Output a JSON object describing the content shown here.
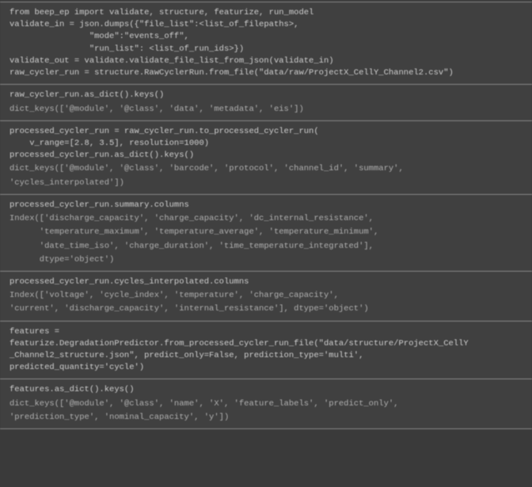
{
  "cells": [
    {
      "lines": [
        "from beep_ep import validate, structure, featurize, run_model",
        "",
        "validate_in = json.dumps({\"file_list\":<list_of_filepaths>,",
        "                \"mode\":\"events_off\",",
        "                \"run_list\": <list_of_run_ids>})",
        "validate_out = validate.validate_file_list_from_json(validate_in)",
        "raw_cycler_run = structure.RawCyclerRun.from_file(\"data/raw/ProjectX_CellY_Channel2.csv\")"
      ],
      "outputs": []
    },
    {
      "lines": [
        "raw_cycler_run.as_dict().keys()"
      ],
      "outputs": [
        "dict_keys(['@module', '@class', 'data', 'metadata', 'eis'])"
      ]
    },
    {
      "lines": [
        "processed_cycler_run = raw_cycler_run.to_processed_cycler_run(",
        "    v_range=[2.8, 3.5], resolution=1000)",
        "processed_cycler_run.as_dict().keys()"
      ],
      "outputs": [
        "dict_keys(['@module', '@class', 'barcode', 'protocol', 'channel_id', 'summary',",
        "'cycles_interpolated'])"
      ]
    },
    {
      "lines": [
        "processed_cycler_run.summary.columns"
      ],
      "outputs": [
        "Index(['discharge_capacity', 'charge_capacity', 'dc_internal_resistance',",
        "      'temperature_maximum', 'temperature_average', 'temperature_minimum',",
        "      'date_time_iso', 'charge_duration', 'time_temperature_integrated'],",
        "      dtype='object')"
      ]
    },
    {
      "lines": [
        "processed_cycler_run.cycles_interpolated.columns"
      ],
      "outputs": [
        "Index(['voltage', 'cycle_index', 'temperature', 'charge_capacity',",
        "'current', 'discharge_capacity', 'internal_resistance'], dtype='object')"
      ]
    },
    {
      "lines": [
        "features =",
        "featurize.DegradationPredictor.from_processed_cycler_run_file(\"data/structure/ProjectX_CellY",
        "_Channel2_structure.json\", predict_only=False, prediction_type='multi',",
        "predicted_quantity='cycle')"
      ],
      "outputs": []
    },
    {
      "lines": [
        "features.as_dict().keys()"
      ],
      "outputs": [
        "dict_keys(['@module', '@class', 'name', 'X', 'feature_labels', 'predict_only',",
        "'prediction_type', 'nominal_capacity', 'y'])"
      ]
    }
  ]
}
